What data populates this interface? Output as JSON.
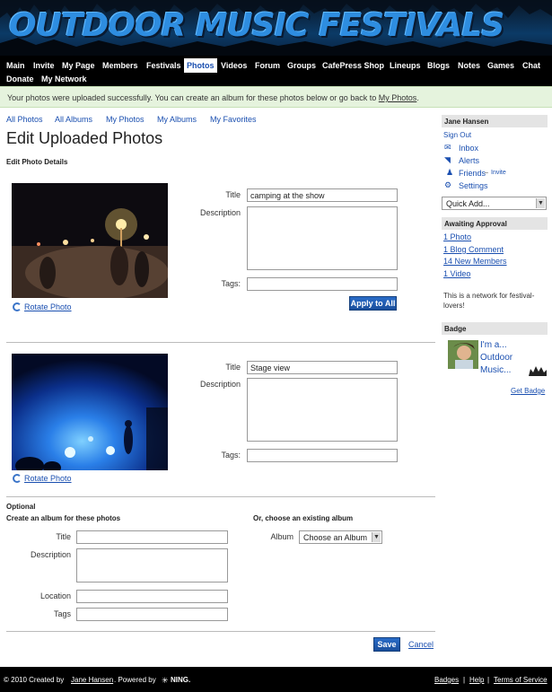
{
  "site": {
    "title": "OUTDOOR MUSIC FESTIVALS"
  },
  "nav": {
    "row1": [
      "Main",
      "Invite",
      "My Page",
      "Members",
      "Festivals",
      "Photos",
      "Videos",
      "Forum",
      "Groups",
      "CafePress Shop",
      "Lineups",
      "Blogs",
      "Notes",
      "Games",
      "Chat"
    ],
    "row2": [
      "Donate",
      "My Network"
    ],
    "active": "Photos"
  },
  "notice": {
    "text": "Your photos were uploaded successfully. You can create an album for these photos below or go back to ",
    "link": "My Photos",
    "end": "."
  },
  "subnav": [
    "All Photos",
    "All Albums",
    "My Photos",
    "My Albums",
    "My Favorites"
  ],
  "page_title": "Edit Uploaded Photos",
  "edit_details_label": "Edit Photo Details",
  "photos": [
    {
      "title_label": "Title",
      "title_value": "camping at the show",
      "description_label": "Description",
      "tags_label": "Tags:",
      "rotate_label": "Rotate Photo"
    },
    {
      "title_label": "Title",
      "title_value": "Stage view",
      "description_label": "Description",
      "tags_label": "Tags:",
      "rotate_label": "Rotate Photo"
    }
  ],
  "apply_all_label": "Apply to All",
  "album": {
    "optional_label": "Optional",
    "create_label": "Create an album for these photos",
    "choose_label": "Or, choose an existing album",
    "title_label": "Title",
    "description_label": "Description",
    "location_label": "Location",
    "tags_label": "Tags",
    "album_label": "Album",
    "album_select_value": "Choose an Album"
  },
  "save_label": "Save",
  "cancel_label": "Cancel",
  "sidebar": {
    "user_name": "Jane Hansen",
    "sign_out": "Sign Out",
    "inbox": "Inbox",
    "alerts": "Alerts",
    "friends": "Friends",
    "invite": "Invite",
    "settings": "Settings",
    "quick_add": "Quick Add...",
    "awaiting_header": "Awaiting Approval",
    "awaiting": [
      "1 Photo",
      "1 Blog Comment",
      "14 New Members",
      "1 Video"
    ],
    "network_desc": "This is a network for festival-lovers!",
    "badge_header": "Badge",
    "badge_text": [
      "I'm a...",
      "Outdoor",
      "Music..."
    ],
    "get_badge": "Get Badge"
  },
  "footer": {
    "copyright": "© 2010   Created by",
    "creator": "Jane Hansen",
    "powered": ".   Powered by",
    "ning": "NING.",
    "links": [
      "Badges",
      "Help",
      "Terms of Service"
    ]
  },
  "colors": {
    "accent": "#1a4fb0",
    "notice_bg": "#e5f3dd",
    "nav_bg": "#000000",
    "sidebar_head_bg": "#e4e4e4"
  }
}
